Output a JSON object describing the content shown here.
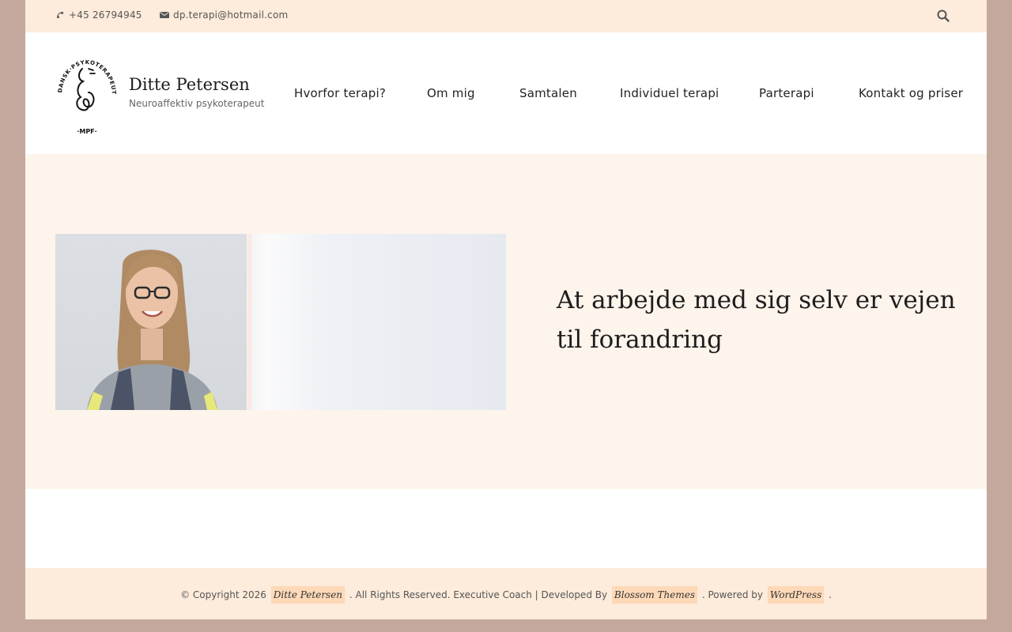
{
  "topbar": {
    "phone": "+45 26794945",
    "email": "dp.terapi@hotmail.com",
    "phone_icon": "phone-icon",
    "email_icon": "envelope-icon",
    "search_icon": "search-icon"
  },
  "brand": {
    "name": "Ditte Petersen",
    "tagline": "Neuroaffektiv psykoterapeut",
    "logo_text_top": "DANSK·PSYKOTERAPEUTFORENING",
    "logo_text_bottom": "MPF"
  },
  "nav": {
    "items": [
      {
        "label": "Hvorfor terapi?"
      },
      {
        "label": "Om mig"
      },
      {
        "label": "Samtalen"
      },
      {
        "label": "Individuel terapi"
      },
      {
        "label": "Parterapi"
      },
      {
        "label": "Kontakt og priser"
      }
    ]
  },
  "hero": {
    "heading": "At arbejde med sig selv er vejen til forandring"
  },
  "footer": {
    "copyright": "© Copyright 2026",
    "site_link": "Ditte Petersen",
    "rights": ". All Rights Reserved. Executive Coach | Developed By",
    "theme_link": "Blossom Themes",
    "powered": ". Powered by",
    "wp_link": "WordPress",
    "end": "."
  },
  "colors": {
    "outer_bg": "#c4a89d",
    "topbar_bg": "#fdebdb",
    "hero_bg": "#fdf4ec",
    "link_highlight": "#fdd9b8"
  }
}
